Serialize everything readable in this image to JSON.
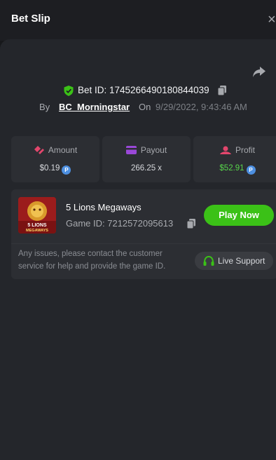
{
  "header": {
    "title": "Bet Slip",
    "close": "×"
  },
  "bet": {
    "id_text": "Bet ID: 1745266490180844039",
    "by_label": "By",
    "username": "BC_Morningstar",
    "on_label": "On",
    "datetime": "9/29/2022, 9:43:46 AM"
  },
  "stats": [
    {
      "label": "Amount",
      "value": "$0.19",
      "icon": "amount-icon",
      "coin": true
    },
    {
      "label": "Payout",
      "value": "266.25 x",
      "icon": "payout-icon",
      "coin": false
    },
    {
      "label": "Profit",
      "value": "$52.91",
      "icon": "profit-icon",
      "coin": true
    }
  ],
  "game": {
    "title": "5 Lions Megaways",
    "id_text": "Game ID: 7212572095613",
    "play_label": "Play Now",
    "thumb_text": "5 LIONS MEGAWAYS",
    "issue_text": "Any issues, please contact the customer service for help and provide the game ID.",
    "support_label": "Live Support"
  },
  "colors": {
    "accent_green": "#3bc117",
    "profit_green": "#57d44b",
    "coin_blue": "#4d8fe0"
  }
}
